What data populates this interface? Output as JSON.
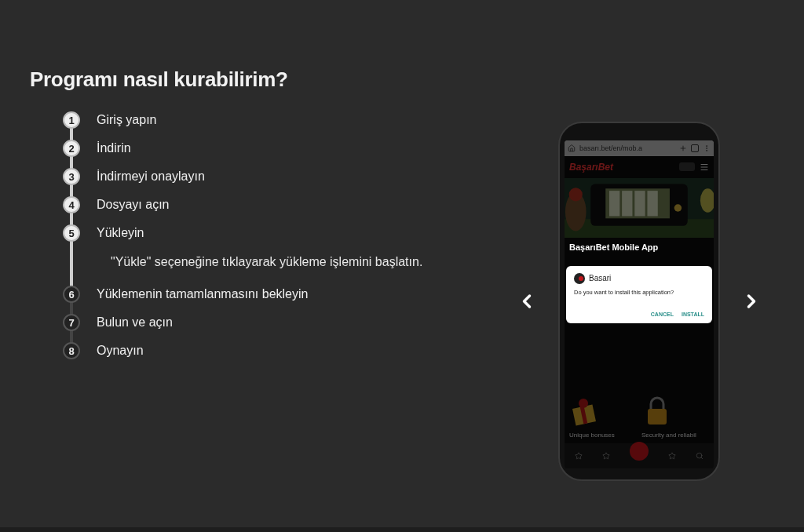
{
  "title": "Programı nasıl kurabilirim?",
  "steps": [
    {
      "number": "1",
      "label": "Giriş yapın",
      "done": true
    },
    {
      "number": "2",
      "label": "İndirin",
      "done": true
    },
    {
      "number": "3",
      "label": "İndirmeyi onaylayın",
      "done": true
    },
    {
      "number": "4",
      "label": "Dosyayı açın",
      "done": true
    },
    {
      "number": "5",
      "label": "Yükleyin",
      "done": true,
      "description": "\"Yükle\" seçeneğine tıklayarak yükleme işlemini başlatın."
    },
    {
      "number": "6",
      "label": "Yüklemenin tamamlanmasını bekleyin",
      "done": false
    },
    {
      "number": "7",
      "label": "Bulun ve açın",
      "done": false
    },
    {
      "number": "8",
      "label": "Oynayın",
      "done": false
    }
  ],
  "phone": {
    "url": "basarı.bet/en/mob.a",
    "logo": "BaşarıBet",
    "heading": "BaşarıBet Mobile App",
    "dialog": {
      "app": "Basari",
      "question": "Do you want to install this application?",
      "buttons": [
        "CANCEL",
        "INSTALL"
      ]
    },
    "features": [
      {
        "title": "Unique bonuses",
        "kind": "gift"
      },
      {
        "title": "Security and reliabil",
        "kind": "lock"
      }
    ]
  }
}
